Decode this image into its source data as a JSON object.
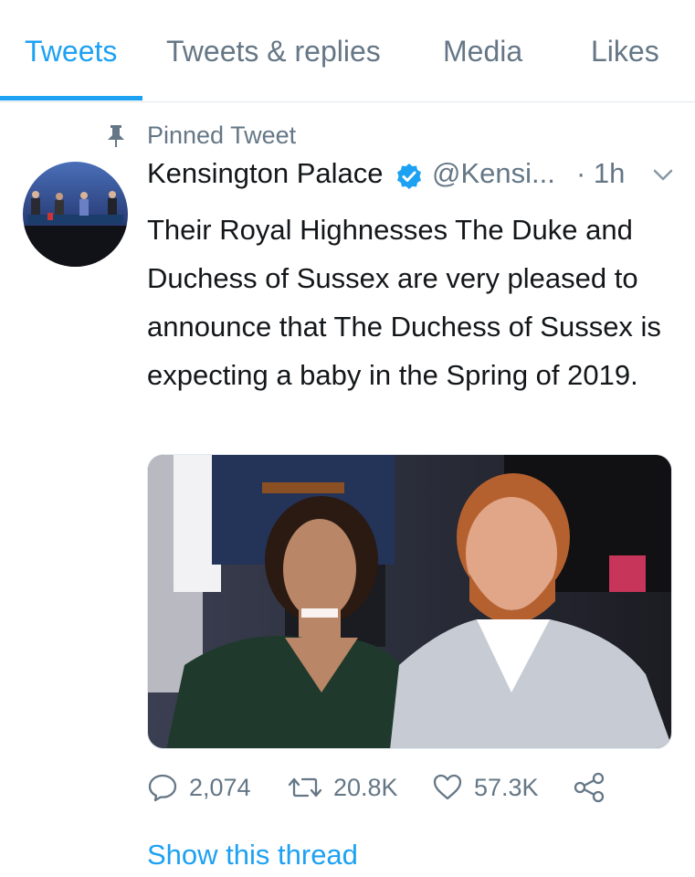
{
  "tabs": [
    {
      "label": "Tweets",
      "active": true
    },
    {
      "label": "Tweets & replies",
      "active": false
    },
    {
      "label": "Media",
      "active": false
    },
    {
      "label": "Likes",
      "active": false
    }
  ],
  "pinned": {
    "label": "Pinned Tweet",
    "icon": "pin-icon"
  },
  "tweet": {
    "author": {
      "display_name": "Kensington Palace",
      "verified": true,
      "handle": "@Kensi...",
      "avatar_icon": "avatar-image"
    },
    "time": "· 1h",
    "text": "Their Royal Highnesses The Duke and Duchess of Sussex are very pleased to announce that The Duchess of Sussex is expecting a baby in the Spring of 2019.",
    "media": {
      "icon": "photo-image"
    },
    "actions": {
      "replies": "2,074",
      "retweets": "20.8K",
      "likes": "57.3K"
    },
    "show_thread": "Show this thread"
  },
  "colors": {
    "accent": "#1da1f2",
    "muted": "#657786",
    "text": "#14171a",
    "divider": "#e1e8ed"
  }
}
